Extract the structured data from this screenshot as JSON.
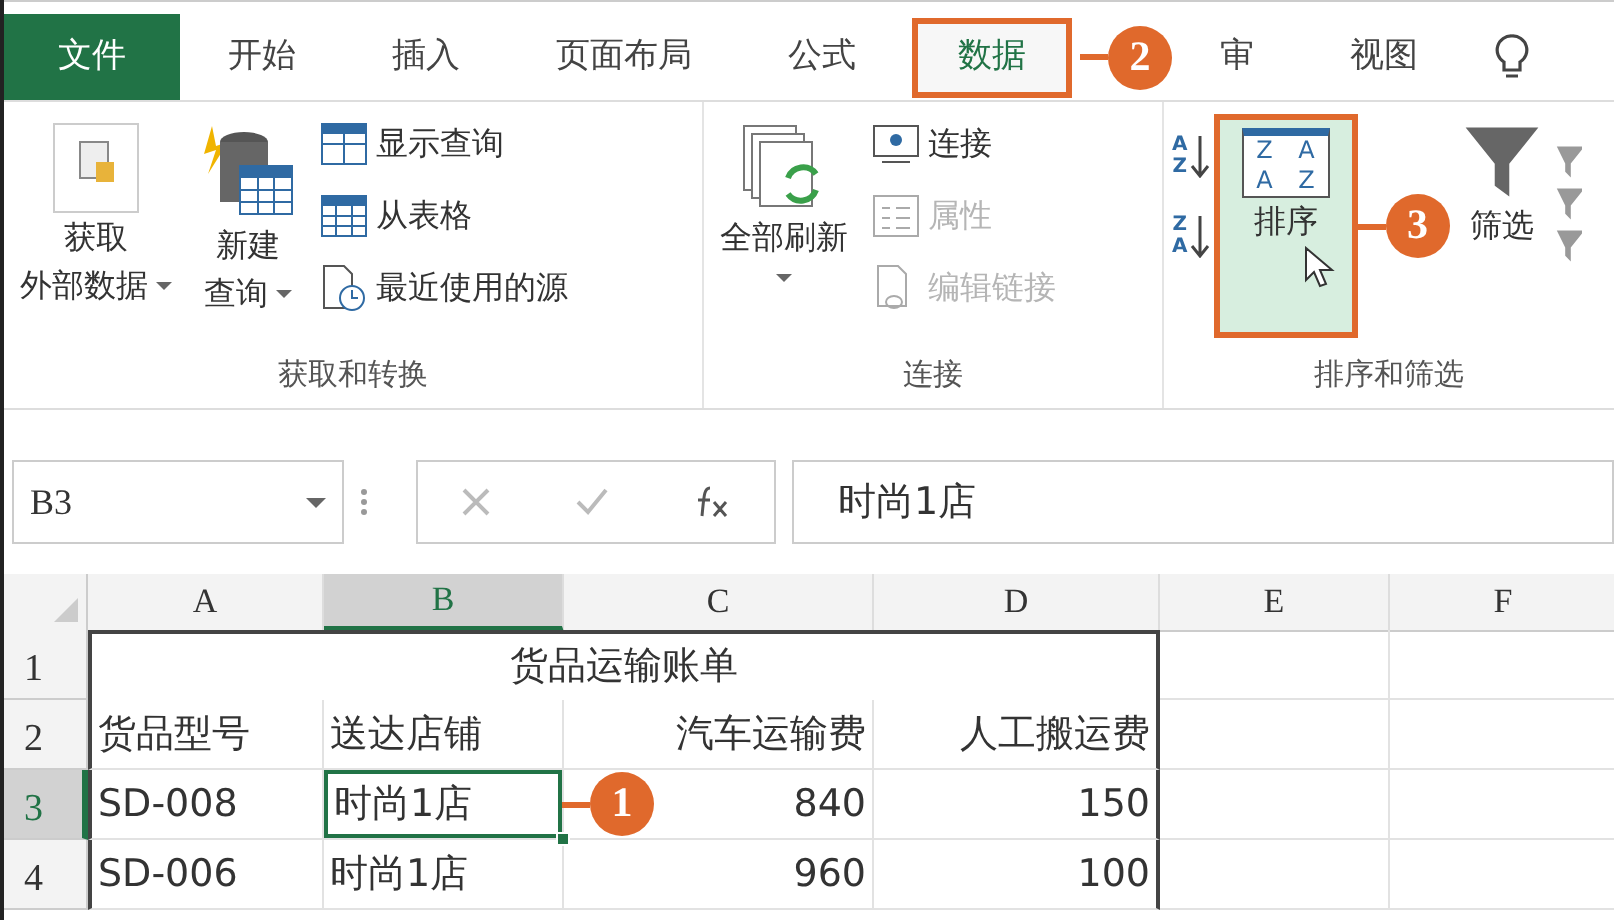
{
  "tabs": [
    {
      "label": "文件",
      "kind": "file",
      "selected": false
    },
    {
      "label": "开始",
      "kind": "tab",
      "selected": false
    },
    {
      "label": "插入",
      "kind": "tab",
      "selected": false
    },
    {
      "label": "页面布局",
      "kind": "tab",
      "selected": false
    },
    {
      "label": "公式",
      "kind": "tab",
      "selected": false
    },
    {
      "label": "数据",
      "kind": "tab",
      "selected": true,
      "callout": "2"
    },
    {
      "label": "审",
      "kind": "tab",
      "selected": false
    },
    {
      "label": "视图",
      "kind": "tab",
      "selected": false
    }
  ],
  "ribbon": {
    "groups": [
      {
        "label": "获取和转换",
        "big_buttons": [
          {
            "lines": [
              "获取",
              "外部数据"
            ],
            "dropdown": true,
            "highlighted": false
          },
          {
            "lines": [
              "新建",
              "查询"
            ],
            "dropdown": true,
            "highlighted": false
          }
        ],
        "small_buttons": [
          {
            "label": "显示查询",
            "disabled": false
          },
          {
            "label": "从表格",
            "disabled": false
          },
          {
            "label": "最近使用的源",
            "disabled": false
          }
        ]
      },
      {
        "label": "连接",
        "big_buttons": [
          {
            "lines": [
              "全部刷新"
            ],
            "dropdown": true,
            "highlighted": false
          }
        ],
        "small_buttons": [
          {
            "label": "连接",
            "disabled": false
          },
          {
            "label": "属性",
            "disabled": true
          },
          {
            "label": "编辑链接",
            "disabled": true
          }
        ]
      },
      {
        "label": "排序和筛选",
        "sort_buttons": [
          {
            "letters": [
              "A",
              "Z"
            ]
          },
          {
            "letters": [
              "Z",
              "A"
            ]
          }
        ],
        "big_buttons": [
          {
            "lines": [
              "排序"
            ],
            "icon_letters": [
              "Z",
              "A",
              "A",
              "Z"
            ],
            "dropdown": false,
            "highlighted": true,
            "callout": "3"
          },
          {
            "lines": [
              "筛选"
            ],
            "dropdown": false,
            "highlighted": false
          }
        ]
      }
    ]
  },
  "formula_bar": {
    "name_box": "B3",
    "value": "时尚1店"
  },
  "sheet": {
    "columns": [
      {
        "label": "A",
        "selected": false
      },
      {
        "label": "B",
        "selected": true
      },
      {
        "label": "C",
        "selected": false
      },
      {
        "label": "D",
        "selected": false
      },
      {
        "label": "E",
        "selected": false
      },
      {
        "label": "F",
        "selected": false
      }
    ],
    "title_row_header": "1",
    "title": "货品运输账单",
    "rows": [
      {
        "header": "2",
        "selected": false,
        "cells": [
          {
            "text": "货品型号",
            "selected": false
          },
          {
            "text": "送达店铺",
            "selected": false
          },
          {
            "text": "汽车运输费",
            "selected": false
          },
          {
            "text": "人工搬运费",
            "selected": false
          }
        ]
      },
      {
        "header": "3",
        "selected": true,
        "callout": "1",
        "cells": [
          {
            "text": "SD-008",
            "selected": false
          },
          {
            "text": "时尚1店",
            "selected": true
          },
          {
            "text": "840",
            "selected": false
          },
          {
            "text": "150",
            "selected": false
          }
        ]
      },
      {
        "header": "4",
        "selected": false,
        "cells": [
          {
            "text": "SD-006",
            "selected": false
          },
          {
            "text": "时尚1店",
            "selected": false
          },
          {
            "text": "960",
            "selected": false
          },
          {
            "text": "100",
            "selected": false
          }
        ]
      }
    ]
  }
}
